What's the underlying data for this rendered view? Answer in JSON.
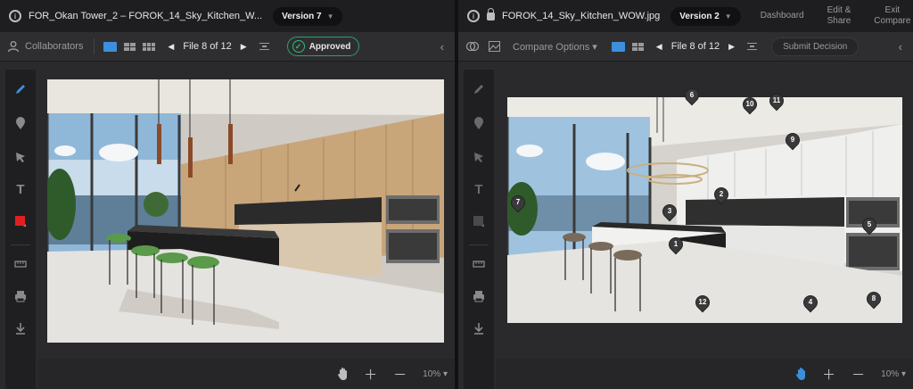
{
  "left": {
    "file_title": "FOR_Okan Tower_2 – FOROK_14_Sky_Kitchen_W...",
    "version_label": "Version 7",
    "collaborators_label": "Collaborators",
    "pager_text": "File 8 of 12",
    "status_label": "Approved",
    "zoom_label": "10%",
    "colors": {
      "approved": "#39b57a",
      "accent": "#3d8fdc",
      "color_swatch": "#e02020"
    }
  },
  "right": {
    "file_title": "FOROK_14_Sky_Kitchen_WOW.jpg",
    "version_label": "Version 2",
    "nav": {
      "dashboard": "Dashboard",
      "edit_share_1": "Edit &",
      "edit_share_2": "Share",
      "exit_compare_1": "Exit",
      "exit_compare_2": "Compare"
    },
    "compare_options_label": "Compare Options",
    "pager_text": "File 8 of 12",
    "submit_decision_label": "Submit Decision",
    "zoom_label": "10%",
    "pins": [
      "1",
      "2",
      "3",
      "4",
      "5",
      "6",
      "7",
      "8",
      "9",
      "10",
      "11",
      "12"
    ]
  },
  "icons": {
    "info": "info-icon",
    "lock": "lock-icon",
    "user": "user-icon",
    "pen": "pen-icon",
    "marker": "marker-icon",
    "arrow": "arrow-tool-icon",
    "text": "text-icon",
    "ruler": "ruler-icon",
    "print": "print-icon",
    "download": "download-icon",
    "hand": "hand-icon",
    "plus": "zoom-in-icon",
    "minus": "zoom-out-icon"
  }
}
